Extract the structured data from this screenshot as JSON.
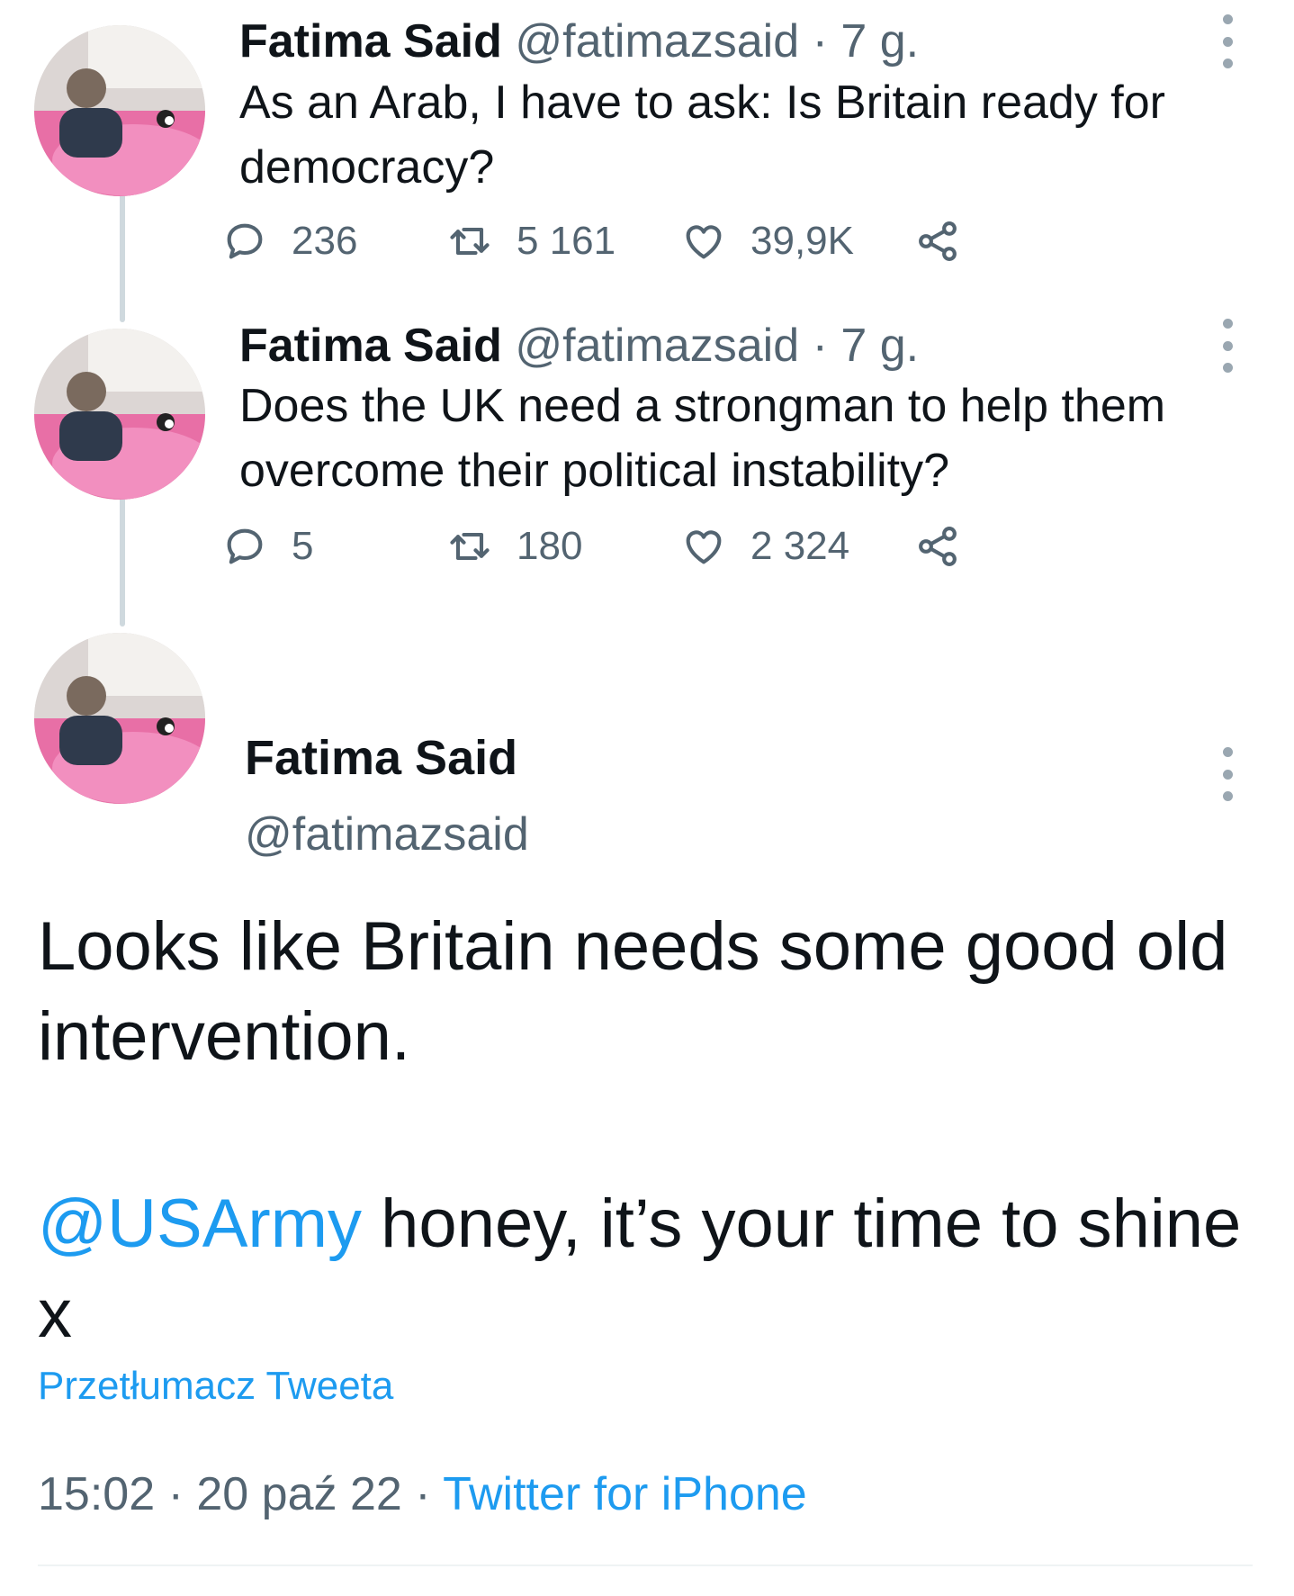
{
  "tweets": [
    {
      "name": "Fatima Said",
      "handle": "@fatimazsaid",
      "separator": "·",
      "time": "7 g.",
      "text": "As an Arab, I have to ask: Is Britain ready for democracy?",
      "replies": "236",
      "retweets": "5 161",
      "likes": "39,9K"
    },
    {
      "name": "Fatima Said",
      "handle": "@fatimazsaid",
      "separator": "·",
      "time": "7 g.",
      "text": "Does the UK need a strongman to help them overcome their political instability?",
      "replies": "5",
      "retweets": "180",
      "likes": "2 324"
    }
  ],
  "main_tweet": {
    "name": "Fatima Said",
    "handle": "@fatimazsaid",
    "text_line1": "Looks like Britain needs some good old intervention.",
    "mention": "@USArmy",
    "text_line2": " honey, it’s your time to shine x",
    "translate_label": "Przetłumacz Tweeta",
    "time": "15:02",
    "date": "20 paź 22",
    "separator": "·",
    "source": "Twitter for iPhone"
  },
  "colors": {
    "text": "#0f1419",
    "secondary": "#536471",
    "link": "#1d9bf0",
    "thread_line": "#cfd9de"
  },
  "icons": [
    "reply-icon",
    "retweet-icon",
    "like-icon",
    "share-icon",
    "more-icon"
  ]
}
